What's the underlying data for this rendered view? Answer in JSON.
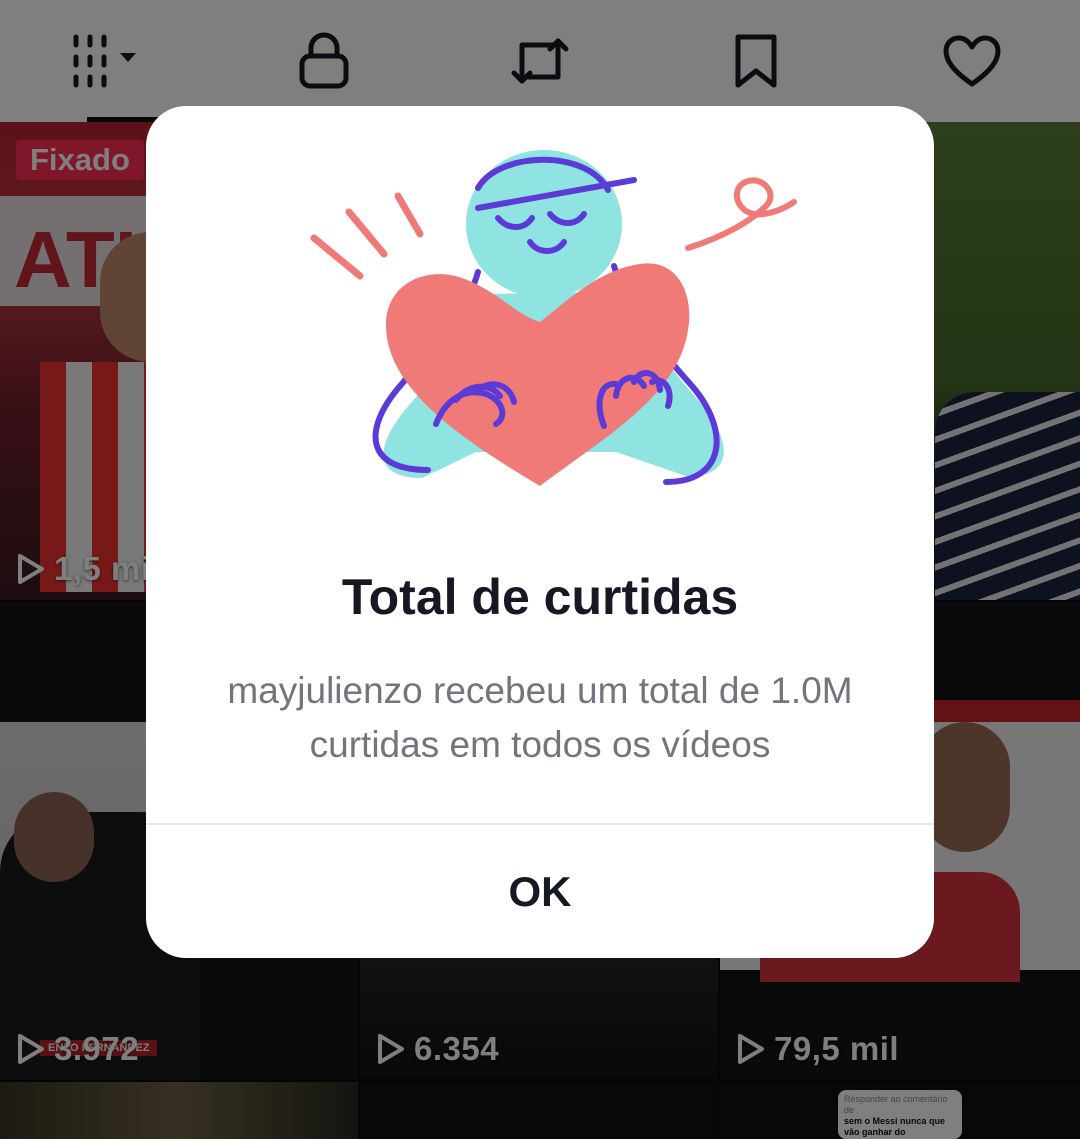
{
  "tabs": [
    {
      "name": "videos",
      "icon": "grid-menu-icon"
    },
    {
      "name": "private",
      "icon": "lock-icon"
    },
    {
      "name": "reposts",
      "icon": "repost-icon"
    },
    {
      "name": "favorites",
      "icon": "bookmark-icon"
    },
    {
      "name": "liked",
      "icon": "heart-icon"
    }
  ],
  "grid": {
    "pinned_label": "Fixado",
    "tiles": [
      {
        "views": "1,5 mi"
      },
      {
        "views": ""
      },
      {
        "views": ""
      },
      {
        "views": "3.972"
      },
      {
        "views": "6.354"
      },
      {
        "views": "79,5 mil"
      }
    ],
    "comment_preview": {
      "reply_line": "Responder ao comentário de",
      "text": "sem o Messi nunca que vão ganhar do"
    }
  },
  "modal": {
    "title": "Total de curtidas",
    "body": "mayjulienzo recebeu um total de 1.0M curtidas em todos os vídeos",
    "ok_label": "OK"
  },
  "colors": {
    "accent": "#fe2c55",
    "illustration_body": "#8fe3e0",
    "illustration_heart": "#f07a78",
    "illustration_line": "#5b3ad8"
  }
}
